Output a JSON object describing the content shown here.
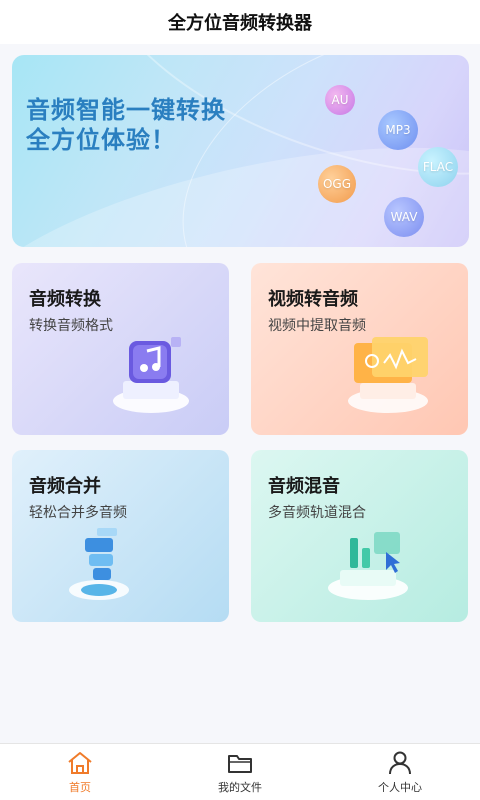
{
  "header": {
    "title": "全方位音频转换器"
  },
  "banner": {
    "slogan_line1": "音频智能一键转换",
    "slogan_line2": "全方位体验！",
    "formats": [
      "AU",
      "MP3",
      "FLAC",
      "OGG",
      "WAV"
    ]
  },
  "cards": [
    {
      "title": "音频转换",
      "subtitle": "转换音频格式"
    },
    {
      "title": "视频转音频",
      "subtitle": "视频中提取音频"
    },
    {
      "title": "音频合并",
      "subtitle": "轻松合并多音频"
    },
    {
      "title": "音频混音",
      "subtitle": "多音频轨道混合"
    }
  ],
  "tabbar": {
    "items": [
      {
        "label": "首页",
        "icon": "home-icon",
        "active": true
      },
      {
        "label": "我的文件",
        "icon": "folder-icon",
        "active": false
      },
      {
        "label": "个人中心",
        "icon": "user-icon",
        "active": false
      }
    ]
  },
  "colors": {
    "accent": "#f07b2a",
    "slogan": "#2a7fc0"
  }
}
